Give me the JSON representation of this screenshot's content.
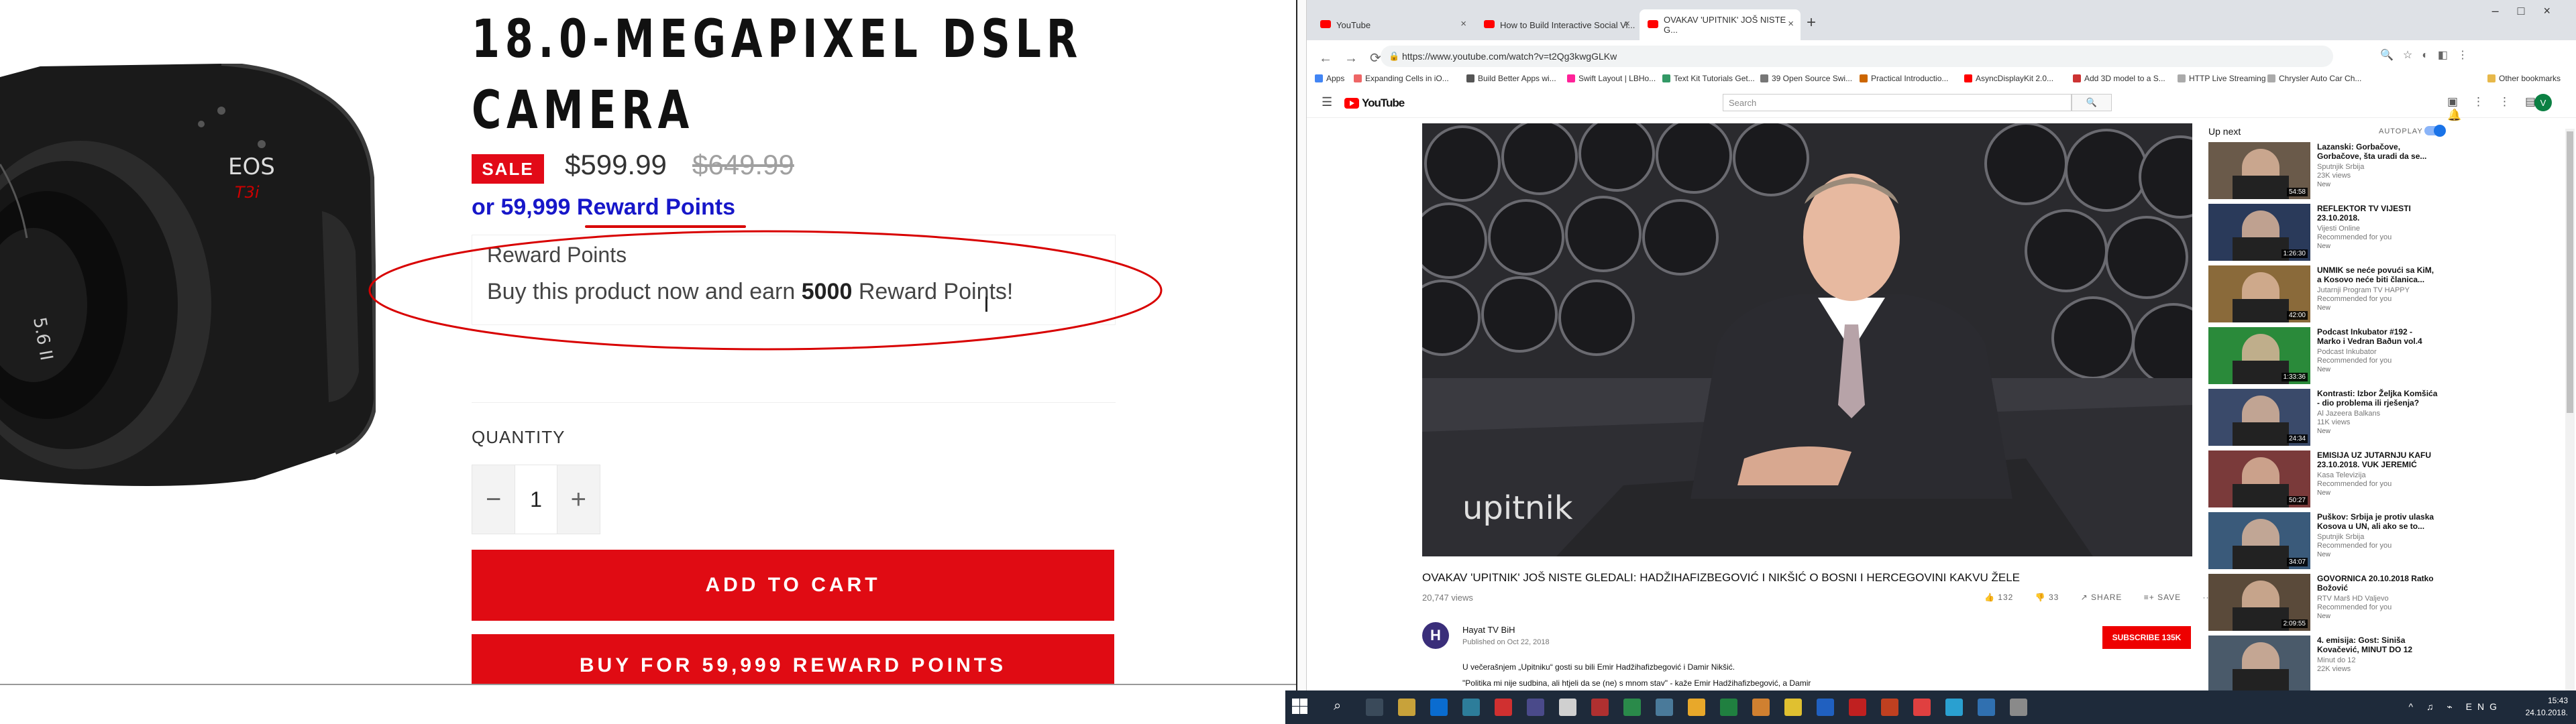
{
  "product": {
    "title_line1": "18.0-MEGAPIXEL DSLR",
    "title_line2": "CAMERA",
    "sale_badge": "SALE",
    "price": "$599.99",
    "old_price": "$649.99",
    "reward_link": "or 59,999 Reward Points",
    "reward_box_title": "Reward Points",
    "reward_desc_pre": "Buy this product now and earn ",
    "reward_desc_points": "5000",
    "reward_desc_post": " Reward Points!",
    "quantity_label": "QUANTITY",
    "quantity_value": "1",
    "minus": "−",
    "plus": "+",
    "add_to_cart": "ADD TO CART",
    "buy_with_points": "BUY FOR 59,999 REWARD POINTS",
    "camera_badge": "EOS",
    "camera_model": "T3i",
    "highlight_color": "#d80000",
    "sale_color": "#e20a17",
    "link_color": "#1717c9"
  },
  "browser": {
    "tabs": [
      {
        "label": "YouTube",
        "icon": "youtube-icon"
      },
      {
        "label": "How to Build Interactive Social Vi...",
        "icon": "youtube-icon"
      },
      {
        "label": "OVAKAV 'UPITNIK' JOŠ NISTE G...",
        "icon": "youtube-icon"
      }
    ],
    "new_tab": "+",
    "window_controls": "–□×",
    "url": "https://www.youtube.com/watch?v=t2Qg3kwgGLKw",
    "bookmarks": [
      "Apps",
      "Expanding Cells in iO...",
      "Build Better Apps wi...",
      "Swift Layout | LBHo...",
      "Text Kit Tutorials Get...",
      "39 Open Source Swi...",
      "Practical Introductio...",
      "AsyncDisplayKit 2.0...",
      "Add 3D model to a S...",
      "HTTP Live Streaming",
      "Chrysler Auto Car Ch...",
      "Other bookmarks"
    ]
  },
  "youtube": {
    "logo": "YouTube",
    "search_placeholder": "Search",
    "avatar_letter": "V",
    "video_title": "OVAKAV 'UPITNIK' JOŠ NISTE GLEDALI: HADŽIHAFIZBEGOVIĆ I NIKŠIĆ O BOSNI I HERCEGOVINI KAKVU ŽELE",
    "views": "20,747 views",
    "likes": "132",
    "dislikes": "33",
    "share": "SHARE",
    "save": "SAVE",
    "more": "···",
    "channel": "Hayat TV BiH",
    "channel_initial": "H",
    "published": "Published on Oct 22, 2018",
    "subscribe": "SUBSCRIBE  135K",
    "desc1": "U večerašnjem „Upitniku“ gosti su bili Emir Hadžihafizbegović i Damir Nikšić.",
    "desc2": "\"Politika mi nije sudbina, ali htjeli da se (ne) s mnom stav\" - kaže Emir Hadžihafizbegović, a Damir",
    "watermark": "upitnik",
    "up_next": "Up next",
    "autoplay": "AUTOPLAY",
    "recs": [
      {
        "title": "Lazanski: Gorbačove, Gorbačove, šta uradi da se...",
        "channel": "Sputnjik Srbija",
        "meta": "23K views",
        "badge": "New",
        "duration": "54:58"
      },
      {
        "title": "REFLEKTOR TV VIJESTI 23.10.2018.",
        "channel": "Vijesti Online",
        "meta": "Recommended for you",
        "badge": "New",
        "duration": "1:26:30"
      },
      {
        "title": "UNMIK se neće povući sa KiM, a Kosovo neće biti članica...",
        "channel": "Jutarnji Program TV HAPPY",
        "meta": "Recommended for you",
        "badge": "New",
        "duration": "42:00"
      },
      {
        "title": "Podcast Inkubator #192 - Marko i Vedran Baðun vol.4",
        "channel": "Podcast Inkubator",
        "meta": "Recommended for you",
        "badge": "New",
        "duration": "1:33:36"
      },
      {
        "title": "Kontrasti: Izbor Željka Komšića - dio problema ili rješenja?",
        "channel": "Al Jazeera Balkans",
        "meta": "11K views",
        "badge": "New",
        "duration": "24:34"
      },
      {
        "title": "EMISIJA UZ JUTARNJU KAFU 23.10.2018. VUK JEREMIĆ",
        "channel": "Kasa Televizija",
        "meta": "Recommended for you",
        "badge": "New",
        "duration": "50:27"
      },
      {
        "title": "Puškov: Srbija je protiv ulaska Kosova u UN, ali ako se to...",
        "channel": "Sputnjik Srbija",
        "meta": "Recommended for you",
        "badge": "New",
        "duration": "34:07"
      },
      {
        "title": "GOVORNICA 20.10.2018 Ratko Božović",
        "channel": "RTV Marš HD Valjevo",
        "meta": "Recommended for you",
        "badge": "New",
        "duration": "2:09:55"
      },
      {
        "title": "4. emisija: Gost: Siniša Kovačević, MINUT DO 12",
        "channel": "Minut do 12",
        "meta": "22K views",
        "badge": "",
        "duration": ""
      }
    ]
  },
  "taskbar": {
    "lang": "ENG",
    "time": "15:43",
    "date": "24.10.2018."
  }
}
